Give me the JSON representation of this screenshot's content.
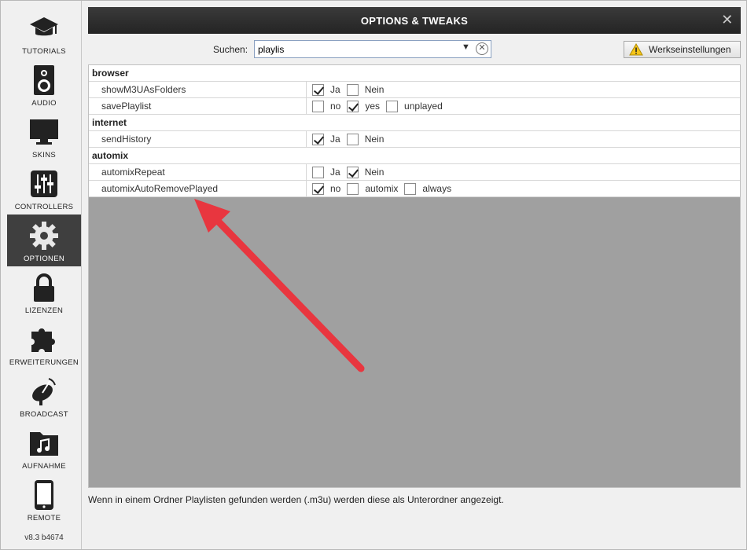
{
  "sidebar": {
    "items": [
      {
        "label": "TUTORIALS",
        "icon": "graduation-cap-icon"
      },
      {
        "label": "AUDIO",
        "icon": "speaker-icon"
      },
      {
        "label": "SKINS",
        "icon": "monitor-icon"
      },
      {
        "label": "CONTROLLERS",
        "icon": "sliders-icon"
      },
      {
        "label": "OPTIONEN",
        "icon": "gear-icon"
      },
      {
        "label": "LIZENZEN",
        "icon": "lock-icon"
      },
      {
        "label": "ERWEITERUNGEN",
        "icon": "puzzle-icon"
      },
      {
        "label": "BROADCAST",
        "icon": "satellite-dish-icon"
      },
      {
        "label": "AUFNAHME",
        "icon": "music-folder-icon"
      },
      {
        "label": "REMOTE",
        "icon": "smartphone-icon"
      }
    ],
    "active": "OPTIONEN",
    "version": "v8.3 b4674"
  },
  "window": {
    "title": "OPTIONS & TWEAKS",
    "close_icon": "close-icon"
  },
  "search": {
    "label": "Suchen:",
    "value": "playlis"
  },
  "toolbar": {
    "reset_label": "Werkseinstellungen",
    "reset_icon": "warning-icon"
  },
  "sections": [
    {
      "title": "browser",
      "options": [
        {
          "name": "showM3UAsFolders",
          "choices": [
            {
              "label": "Ja",
              "checked": true
            },
            {
              "label": "Nein",
              "checked": false
            }
          ]
        },
        {
          "name": "savePlaylist",
          "choices": [
            {
              "label": "no",
              "checked": false
            },
            {
              "label": "yes",
              "checked": true
            },
            {
              "label": "unplayed",
              "checked": false
            }
          ]
        }
      ]
    },
    {
      "title": "internet",
      "options": [
        {
          "name": "sendHistory",
          "choices": [
            {
              "label": "Ja",
              "checked": true
            },
            {
              "label": "Nein",
              "checked": false
            }
          ]
        }
      ]
    },
    {
      "title": "automix",
      "options": [
        {
          "name": "automixRepeat",
          "choices": [
            {
              "label": "Ja",
              "checked": false
            },
            {
              "label": "Nein",
              "checked": true
            }
          ]
        },
        {
          "name": "automixAutoRemovePlayed",
          "choices": [
            {
              "label": "no",
              "checked": true
            },
            {
              "label": "automix",
              "checked": false
            },
            {
              "label": "always",
              "checked": false
            }
          ]
        }
      ]
    }
  ],
  "status": {
    "text": "Wenn in einem Ordner Playlisten gefunden werden (.m3u) werden diese als Unterordner angezeigt."
  },
  "colors": {
    "active_nav": "#3f3f3f",
    "titlebar": "#2c2c2c",
    "panel_bg": "#a0a0a0",
    "annotation_arrow": "#e8363f"
  }
}
